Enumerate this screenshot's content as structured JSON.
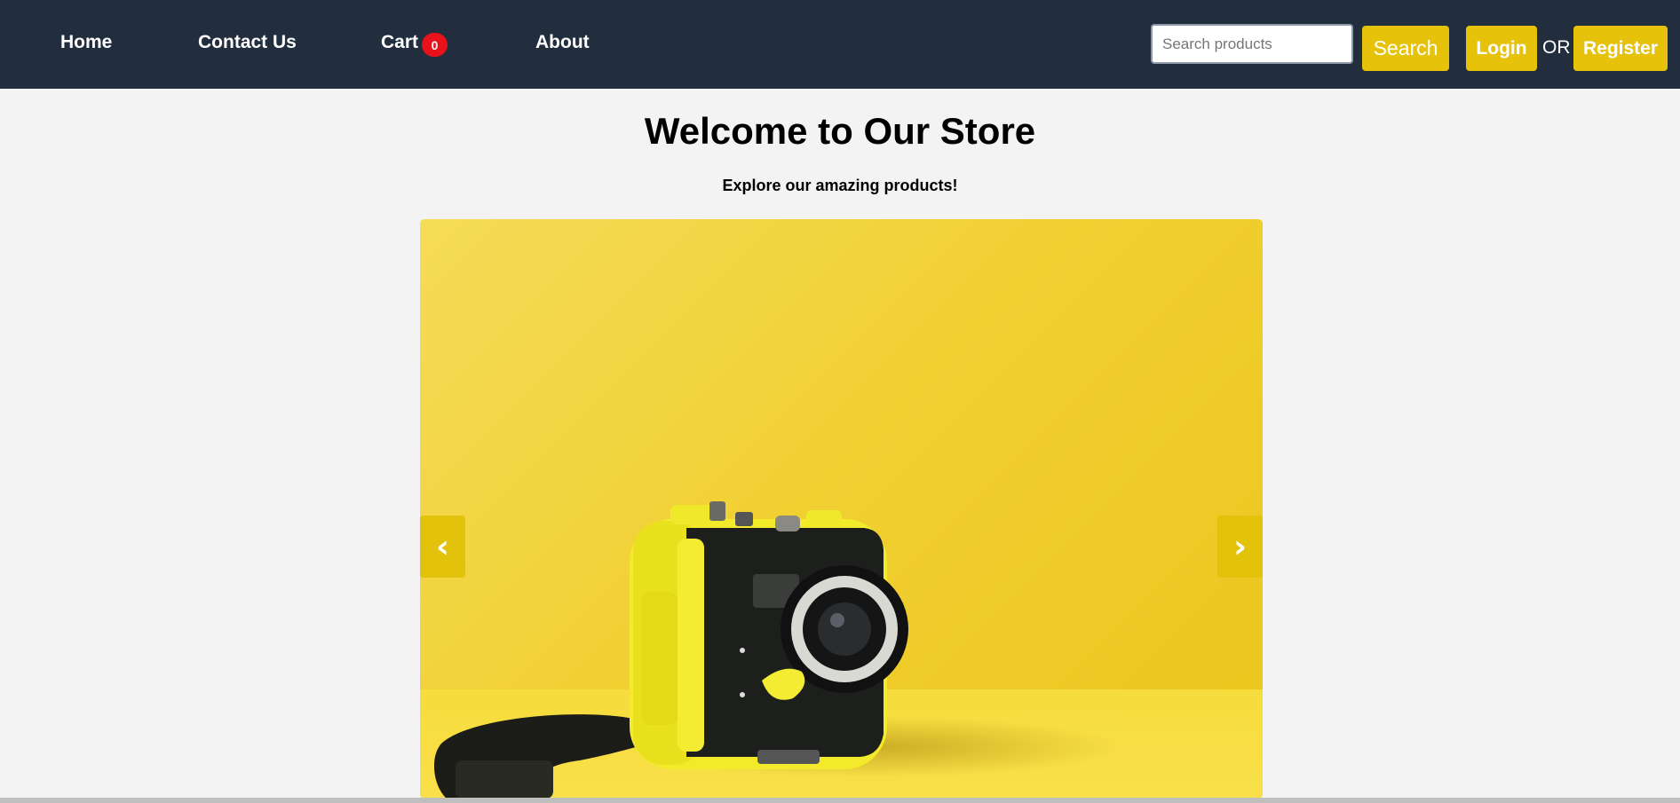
{
  "nav": {
    "links": [
      {
        "label": "Home"
      },
      {
        "label": "Contact Us"
      },
      {
        "label": "Cart"
      },
      {
        "label": "About"
      }
    ],
    "cart_count": "0",
    "search_placeholder": "Search products",
    "search_label": "Search",
    "login_label": "Login",
    "or_text": "OR",
    "register_label": "Register"
  },
  "main": {
    "title": "Welcome to Our Store",
    "subtitle": "Explore our amazing products!"
  },
  "slider": {
    "prev_icon": "chevron-left-icon",
    "next_icon": "chevron-right-icon",
    "prev_glyph": "‹",
    "next_glyph": "›",
    "image": "yellow underwater camera product photo"
  },
  "colors": {
    "navbar": "#222d3e",
    "accent": "#e6c30a",
    "badge": "#e8121a",
    "background": "#f3f3f3"
  }
}
